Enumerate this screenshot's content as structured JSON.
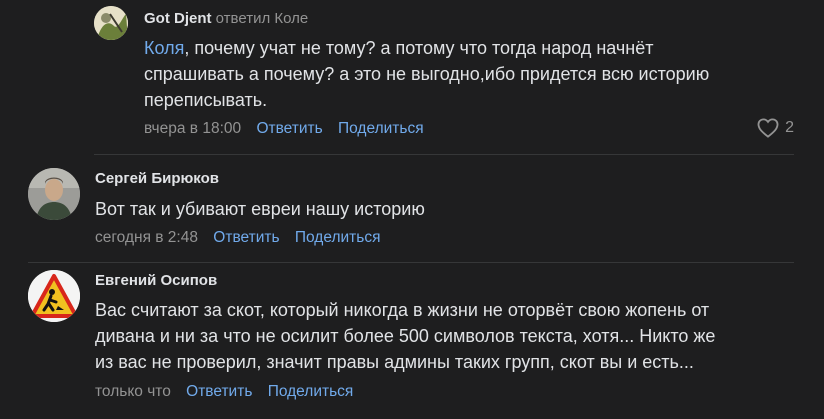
{
  "comments": [
    {
      "author": "Got Djent",
      "reply_label": "ответил Коле",
      "mention": "Коля",
      "text_line1_rest": ", почему учат не тому? а потому что тогда народ начнёт",
      "text_line2": "спрашивать а почему? а это не выгодно,ибо придется всю историю",
      "text_line3": "переписывать.",
      "time": "вчера в 18:00",
      "reply_action": "Ответить",
      "share_action": "Поделиться",
      "likes": "2"
    },
    {
      "author": "Сергей Бирюков",
      "text_line1": "Вот так и убивают евреи нашу историю",
      "time": "сегодня в 2:48",
      "reply_action": "Ответить",
      "share_action": "Поделиться"
    },
    {
      "author": "Евгений Осипов",
      "text_line1": "Вас считают за скот, который никогда в жизни не оторвёт свою жопень от",
      "text_line2": "дивана и ни за что не осилит более 500 символов текста, хотя... Никто же",
      "text_line3": "из вас не проверил, значит правы админы таких групп, скот вы и есть...",
      "time": "только что",
      "reply_action": "Ответить",
      "share_action": "Поделиться"
    }
  ]
}
